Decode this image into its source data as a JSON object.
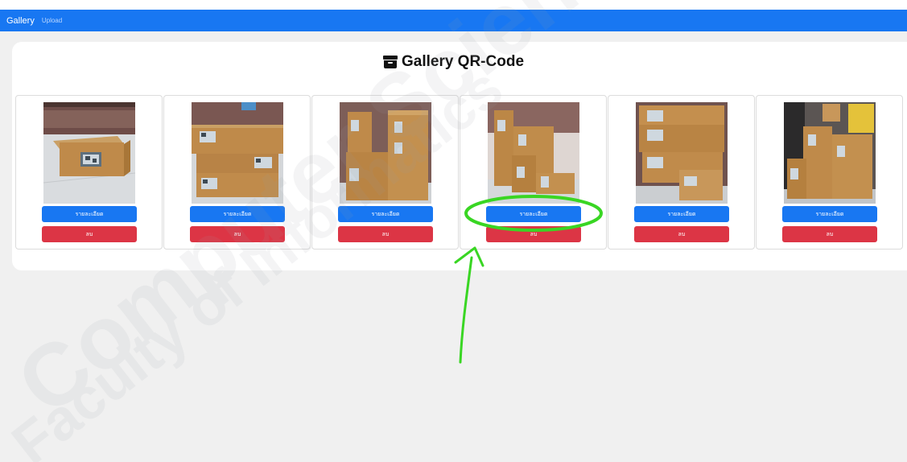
{
  "navbar": {
    "brand": "Gallery",
    "upload_label": "Upload"
  },
  "page": {
    "title": "Gallery QR-Code",
    "title_icon": "archive-box-icon"
  },
  "cards": [
    {
      "detail_label": "รายละเอียด",
      "delete_label": "ลบ"
    },
    {
      "detail_label": "รายละเอียด",
      "delete_label": "ลบ"
    },
    {
      "detail_label": "รายละเอียด",
      "delete_label": "ลบ"
    },
    {
      "detail_label": "รายละเอียด",
      "delete_label": "ลบ"
    },
    {
      "detail_label": "รายละเอียด",
      "delete_label": "ลบ"
    },
    {
      "detail_label": "รายละเอียด",
      "delete_label": "ลบ"
    }
  ],
  "colors": {
    "navbar": "#1877f2",
    "detail_button": "#1877f2",
    "delete_button": "#dc3545",
    "annotation": "#39d623"
  }
}
